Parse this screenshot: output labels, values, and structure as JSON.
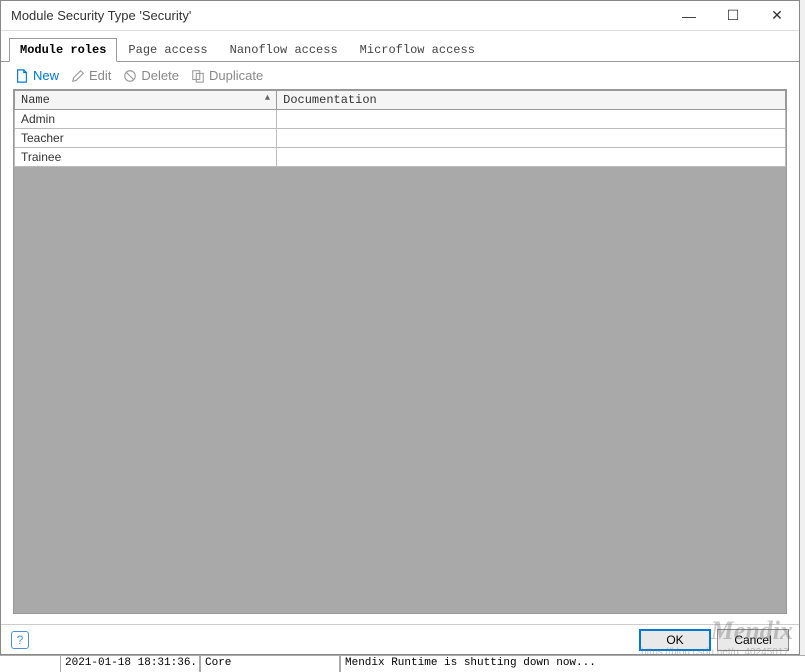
{
  "window": {
    "title": "Module Security Type 'Security'"
  },
  "tabs": [
    {
      "label": "Module roles",
      "active": true
    },
    {
      "label": "Page access",
      "active": false
    },
    {
      "label": "Nanoflow access",
      "active": false
    },
    {
      "label": "Microflow access",
      "active": false
    }
  ],
  "toolbar": {
    "new_label": "New",
    "edit_label": "Edit",
    "delete_label": "Delete",
    "duplicate_label": "Duplicate"
  },
  "table": {
    "columns": [
      "Name",
      "Documentation"
    ],
    "rows": [
      {
        "name": "Admin",
        "documentation": ""
      },
      {
        "name": "Teacher",
        "documentation": ""
      },
      {
        "name": "Trainee",
        "documentation": ""
      }
    ]
  },
  "footer": {
    "ok_label": "OK",
    "cancel_label": "Cancel"
  },
  "watermark": {
    "text": "Mendix",
    "url": "https://blog.csdn.net/u_40245017"
  },
  "statusbar": {
    "timestamp": "2021-01-18 18:31:36...",
    "module": "Core",
    "message": "Mendix Runtime is shutting down now..."
  }
}
